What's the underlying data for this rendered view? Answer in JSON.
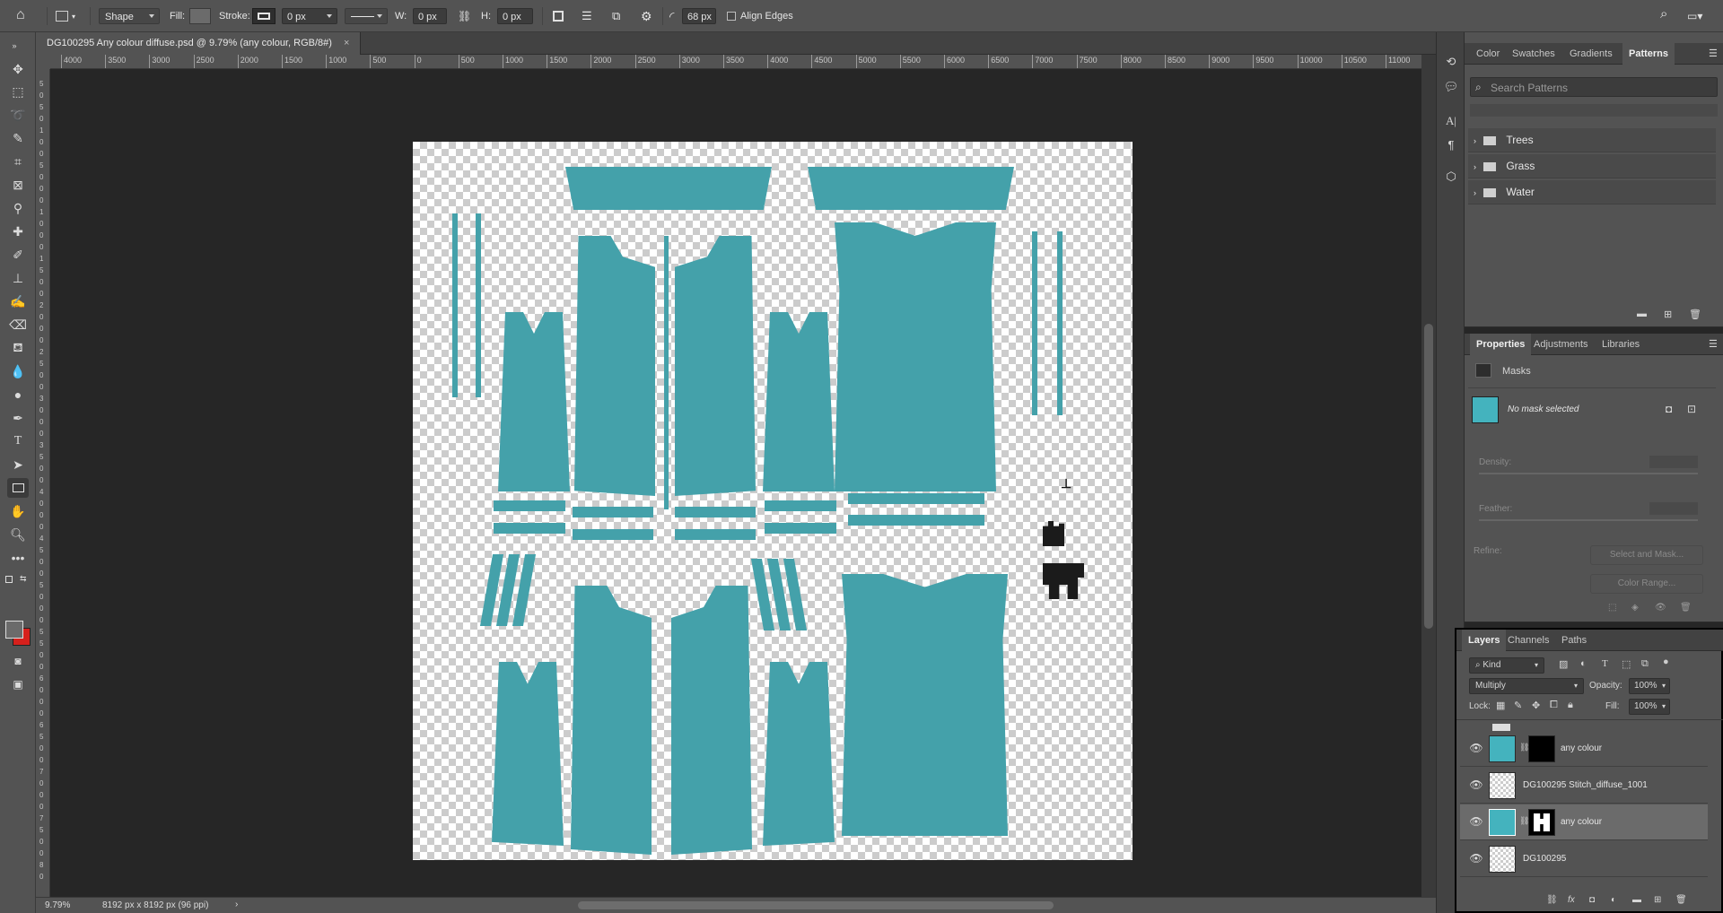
{
  "options_bar": {
    "mode": "Shape",
    "fill_label": "Fill:",
    "stroke_label": "Stroke:",
    "stroke_width": "0 px",
    "w_label": "W:",
    "w_value": "0 px",
    "h_label": "H:",
    "h_value": "0 px",
    "radius_value": "68 px",
    "align_edges": "Align Edges"
  },
  "document": {
    "tab_title": "DG100295 Any colour diffuse.psd @ 9.79% (any colour, RGB/8#)",
    "close": "×",
    "piece_color": "#44a1aa"
  },
  "ruler": {
    "h_ticks": [
      "4000",
      "3500",
      "3000",
      "2500",
      "2000",
      "1500",
      "1000",
      "500",
      "0",
      "500",
      "1000",
      "1500",
      "2000",
      "2500",
      "3000",
      "3500",
      "4000",
      "4500",
      "5000",
      "5500",
      "6000",
      "6500",
      "7000",
      "7500",
      "8000",
      "8500",
      "9000",
      "9500",
      "10000",
      "10500",
      "11000"
    ],
    "v_ticks": [
      "5",
      "0",
      "5",
      "0",
      "1",
      "0",
      "0",
      "5",
      "0",
      "0",
      "0",
      "1",
      "0",
      "0",
      "0",
      "1",
      "5",
      "0",
      "0",
      "2",
      "0",
      "0",
      "0",
      "2",
      "5",
      "0",
      "0",
      "3",
      "0",
      "0",
      "0",
      "3",
      "5",
      "0",
      "0",
      "4",
      "0",
      "0",
      "0",
      "4",
      "5",
      "0",
      "0",
      "5",
      "0",
      "0",
      "0",
      "5",
      "5",
      "0",
      "0",
      "6",
      "0",
      "0",
      "0",
      "6",
      "5",
      "0",
      "0",
      "7",
      "0",
      "0",
      "0",
      "7",
      "5",
      "0",
      "0",
      "8",
      "0"
    ]
  },
  "status": {
    "zoom": "9.79%",
    "doc_size": "8192 px x 8192 px (96 ppi)",
    "arrow": "›"
  },
  "patterns_panel": {
    "tabs": [
      "Color",
      "Swatches",
      "Gradients",
      "Patterns"
    ],
    "active_tab": "Patterns",
    "search_placeholder": "Search Patterns",
    "folders": [
      "Trees",
      "Grass",
      "Water"
    ]
  },
  "properties_panel": {
    "tabs": [
      "Properties",
      "Adjustments",
      "Libraries"
    ],
    "active_tab": "Properties",
    "section": "Masks",
    "no_mask": "No mask selected",
    "density_label": "Density:",
    "feather_label": "Feather:",
    "refine_label": "Refine:",
    "select_mask": "Select and Mask...",
    "color_range": "Color Range..."
  },
  "layers_panel": {
    "tabs": [
      "Layers",
      "Channels",
      "Paths"
    ],
    "active_tab": "Layers",
    "filter_kind": "Kind",
    "blend_mode": "Multiply",
    "opacity_label": "Opacity:",
    "opacity_value": "100%",
    "lock_label": "Lock:",
    "fill_label": "Fill:",
    "fill_value": "100%",
    "layers": [
      {
        "name": "any colour",
        "type": "color-mask-dark",
        "selected": false
      },
      {
        "name": "DG100295 Stitch_diffuse_1001",
        "type": "transparent",
        "selected": false
      },
      {
        "name": "any colour",
        "type": "color-mask-light",
        "selected": true
      },
      {
        "name": "DG100295",
        "type": "transparent",
        "selected": false
      }
    ]
  }
}
